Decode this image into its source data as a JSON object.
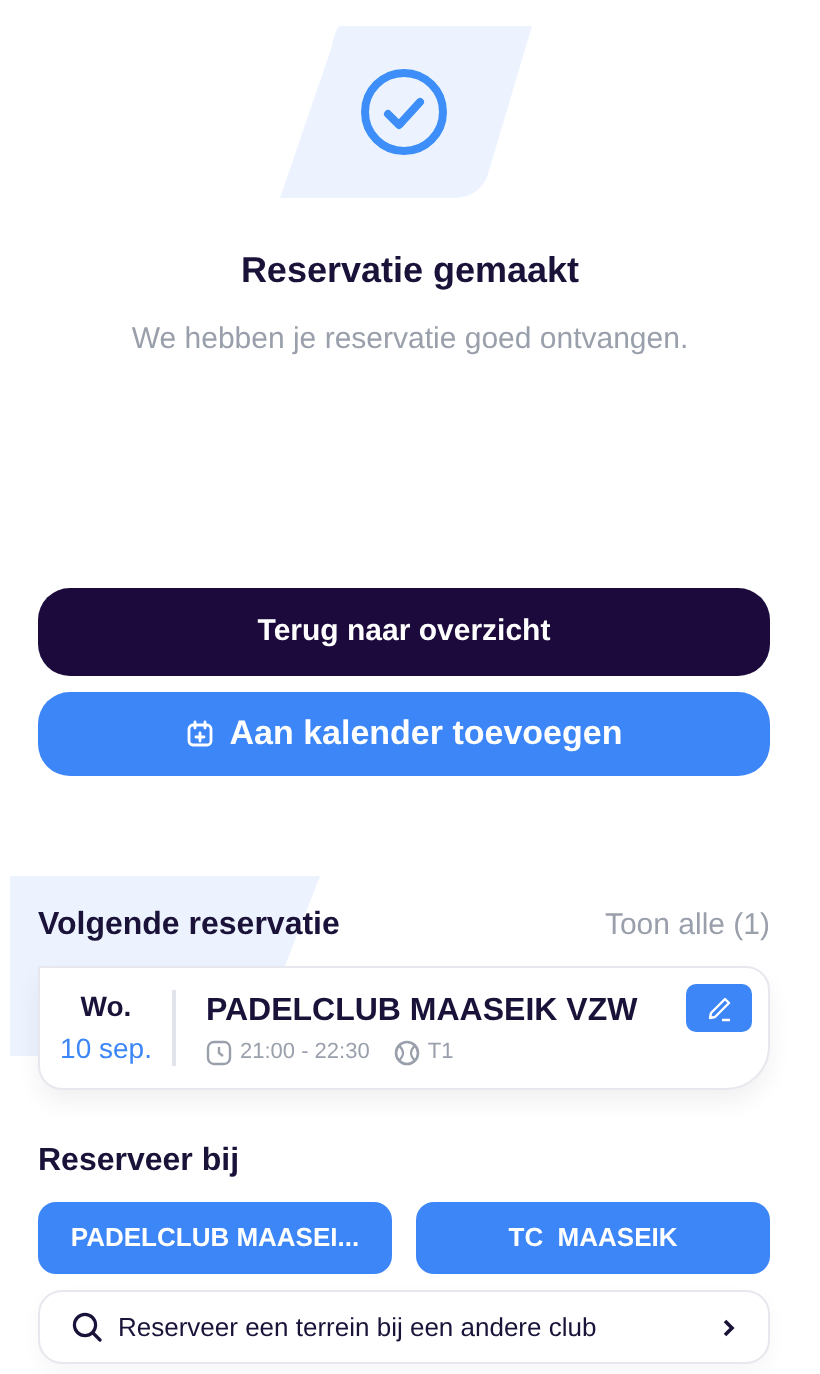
{
  "header": {
    "title": "Reservatie gemaakt",
    "subtitle": "We hebben je reservatie goed ontvangen."
  },
  "actions": [
    {
      "kind": "dark",
      "label": "Terug naar overzicht"
    },
    {
      "kind": "calendar",
      "label": "Aan kalender toevoegen"
    }
  ],
  "next_reservation": {
    "title": "Volgende reservatie",
    "show_all": "Toon alle (1)",
    "day": "Wo.",
    "date": "10 sep.",
    "club": "PADELCLUB MAASEIK VZW",
    "time": "21:00 - 22:30",
    "court": "T1"
  },
  "reserve_at": {
    "title": "Reserveer bij",
    "clubs": [
      "PADELCLUB MAASEI...",
      "TC  MAASEIK"
    ],
    "search": "Reserveer een terrein bij een andere club"
  }
}
